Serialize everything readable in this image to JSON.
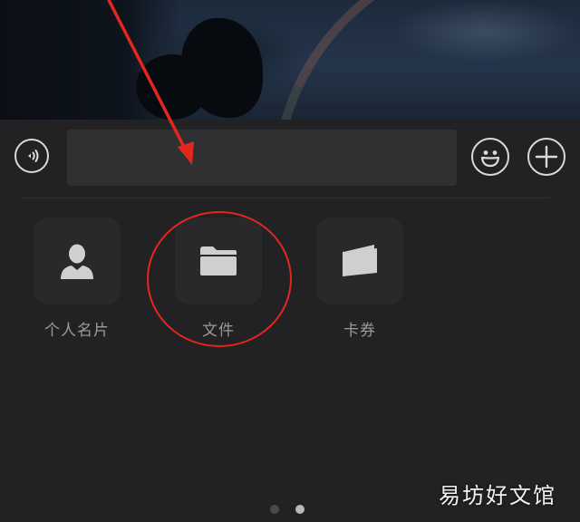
{
  "input_bar": {
    "voice_icon": "voice-wave-icon",
    "text_value": "",
    "emoji_icon": "emoji-smile-icon",
    "plus_icon": "plus-circle-icon"
  },
  "tools": [
    {
      "label": "个人名片",
      "icon": "contact-card-person-icon"
    },
    {
      "label": "文件",
      "icon": "folder-icon"
    },
    {
      "label": "卡券",
      "icon": "coupon-card-icon"
    }
  ],
  "pager": {
    "pages": 2,
    "current": 2
  },
  "watermark": {
    "text": "易坊好文馆"
  },
  "colors": {
    "panel_bg": "#222224",
    "tile_bg": "#29292b",
    "label": "#9a9a9a",
    "annotation": "#e5261f"
  }
}
